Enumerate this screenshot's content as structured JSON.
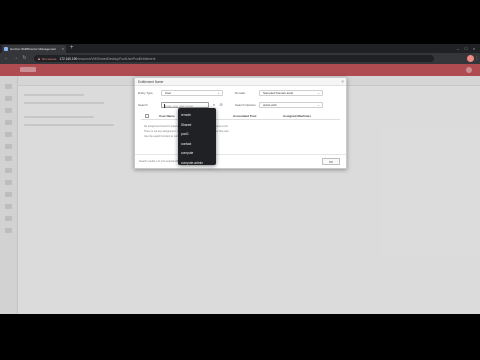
{
  "browser": {
    "tab_title": "Horizon ShiftDirector Management",
    "url_warning": "Not secure",
    "url_host": "172.160.190",
    "url_path": "/resource/VM/SharedDesktopPool/UserPoolEntitlement"
  },
  "dialog": {
    "title": "Entitlement Name",
    "close_label": "×",
    "fields": {
      "entity_label": "Entity Type",
      "entity_value": "User",
      "domain_label": "Domain",
      "domain_value": "Sampled Domain.local",
      "search_label": "Search",
      "search_placeholder": "Enter one user name",
      "filter_label": "Search Options",
      "filter_value": "starts with"
    },
    "table": {
      "headers": [
        "User Name",
        "Associated Pool",
        "Assigned Machines"
      ]
    },
    "info_lines": [
      "No assignment found in selected domain. Please input the user name to list.",
      "There is not any assignment. Click to retrieve all assigned users for this pool.",
      "Use the search function to retrieve the user details."
    ],
    "footer_text": "Search results 1 of 1 for selected filter on 1 result",
    "ok_label": "OK"
  },
  "dropdown": {
    "options": [
      "remote",
      "Shared",
      "pool1",
      "contact",
      "compute",
      "compute-admin",
      "Prompt"
    ]
  }
}
